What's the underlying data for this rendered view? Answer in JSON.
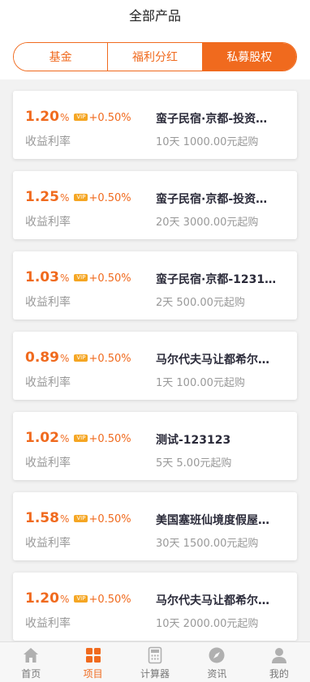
{
  "header": {
    "title": "全部产品"
  },
  "segments": [
    {
      "label": "基金",
      "active": false
    },
    {
      "label": "福利分红",
      "active": false
    },
    {
      "label": "私募股权",
      "active": true
    }
  ],
  "products": [
    {
      "rate": "1.20",
      "percent": "%",
      "vip_tag": "VIP",
      "extra": "+0.50%",
      "rate_label": "收益利率",
      "name": "蛮子民宿·京都-投资…",
      "terms": "10天 1000.00元起购"
    },
    {
      "rate": "1.25",
      "percent": "%",
      "vip_tag": "VIP",
      "extra": "+0.50%",
      "rate_label": "收益利率",
      "name": "蛮子民宿·京都-投资…",
      "terms": "20天 3000.00元起购"
    },
    {
      "rate": "1.03",
      "percent": "%",
      "vip_tag": "VIP",
      "extra": "+0.50%",
      "rate_label": "收益利率",
      "name": "蛮子民宿·京都-1231…",
      "terms": "2天 500.00元起购"
    },
    {
      "rate": "0.89",
      "percent": "%",
      "vip_tag": "VIP",
      "extra": "+0.50%",
      "rate_label": "收益利率",
      "name": "马尔代夫马让都希尔…",
      "terms": "1天 100.00元起购"
    },
    {
      "rate": "1.02",
      "percent": "%",
      "vip_tag": "VIP",
      "extra": "+0.50%",
      "rate_label": "收益利率",
      "name": "测试-123123",
      "terms": "5天 5.00元起购"
    },
    {
      "rate": "1.58",
      "percent": "%",
      "vip_tag": "VIP",
      "extra": "+0.50%",
      "rate_label": "收益利率",
      "name": "美国塞班仙境度假屋…",
      "terms": "30天 1500.00元起购"
    },
    {
      "rate": "1.20",
      "percent": "%",
      "vip_tag": "VIP",
      "extra": "+0.50%",
      "rate_label": "收益利率",
      "name": "马尔代夫马让都希尔…",
      "terms": "10天 2000.00元起购"
    }
  ],
  "tabbar": [
    {
      "label": "首页",
      "icon": "home-icon",
      "active": false
    },
    {
      "label": "项目",
      "icon": "grid-icon",
      "active": true
    },
    {
      "label": "计算器",
      "icon": "calculator-icon",
      "active": false
    },
    {
      "label": "资讯",
      "icon": "compass-icon",
      "active": false
    },
    {
      "label": "我的",
      "icon": "user-icon",
      "active": false
    }
  ],
  "colors": {
    "accent": "#f06a1e",
    "vip": "#f5a623",
    "muted": "#999999",
    "background": "#f2f2f2"
  }
}
